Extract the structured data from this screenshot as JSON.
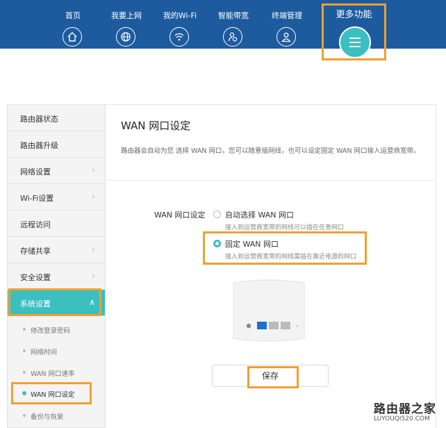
{
  "top_nav": {
    "items": [
      {
        "label": "首页",
        "icon": "home-icon"
      },
      {
        "label": "我要上网",
        "icon": "globe-icon"
      },
      {
        "label": "我的Wi-Fi",
        "icon": "wifi-icon"
      },
      {
        "label": "智能带宽",
        "icon": "bandwidth-icon"
      },
      {
        "label": "终端管理",
        "icon": "user-icon"
      }
    ],
    "more": {
      "label": "更多功能",
      "icon": "menu-icon"
    }
  },
  "sidebar": {
    "items": [
      {
        "label": "路由器状态",
        "chevron": false
      },
      {
        "label": "路由器升级",
        "chevron": false
      },
      {
        "label": "网络设置",
        "chevron": true
      },
      {
        "label": "Wi-Fi设置",
        "chevron": true
      },
      {
        "label": "远程访问",
        "chevron": false
      },
      {
        "label": "存储共享",
        "chevron": true
      },
      {
        "label": "安全设置",
        "chevron": true
      },
      {
        "label": "系统设置",
        "chevron": true,
        "expanded": true
      }
    ],
    "sub_items": [
      {
        "label": "修改登录密码"
      },
      {
        "label": "网络时间"
      },
      {
        "label": "WAN 网口速率"
      },
      {
        "label": "WAN 网口设定",
        "current": true
      },
      {
        "label": "备份与恢复"
      }
    ]
  },
  "panel": {
    "title": "WAN 网口设定",
    "description": "路由器会自动为您 选择 WAN 网口，您可以随意插网线，也可以设定固定 WAN 网口接入运营商宽带。",
    "field_label": "WAN 网口设定",
    "options": [
      {
        "label": "自动选择 WAN 网口",
        "hint": "接入到运营商宽带的网线可以插在任意网口",
        "selected": false
      },
      {
        "label": "固定 WAN 网口",
        "hint": "接入到运营商宽带的网线需插在靠近电源的网口",
        "selected": true
      }
    ],
    "save_label": "保存"
  },
  "watermark": {
    "main": "路由器之家",
    "sub": "LUYOUQI520.COM"
  },
  "colors": {
    "header": "#1d5b9e",
    "accent": "#3bbfc0",
    "highlight": "#f0a030",
    "port_active": "#1e6fd0"
  }
}
